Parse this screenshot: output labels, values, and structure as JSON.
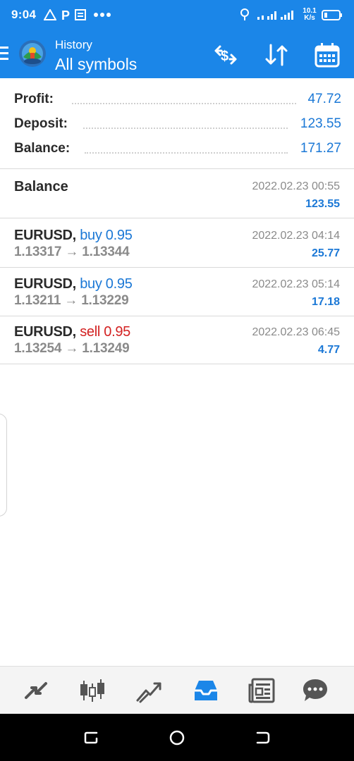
{
  "status_bar": {
    "time": "9:04",
    "speed_top": "10.1",
    "speed_bottom": "K/s"
  },
  "app_bar": {
    "title": "History",
    "subtitle": "All symbols"
  },
  "summary": [
    {
      "label": "Profit:",
      "value": "47.72"
    },
    {
      "label": "Deposit:",
      "value": "123.55"
    },
    {
      "label": "Balance:",
      "value": "171.27"
    }
  ],
  "balance_entry": {
    "title": "Balance",
    "date": "2022.02.23 00:55",
    "amount": "123.55"
  },
  "trades": [
    {
      "symbol": "EURUSD,",
      "side": "buy 0.95",
      "side_type": "buy",
      "prices": "1.13317 → 1.13344",
      "date": "2022.02.23 04:14",
      "amount": "25.77"
    },
    {
      "symbol": "EURUSD,",
      "side": "buy 0.95",
      "side_type": "buy",
      "prices": "1.13211 → 1.13229",
      "date": "2022.02.23 05:14",
      "amount": "17.18"
    },
    {
      "symbol": "EURUSD,",
      "side": "sell 0.95",
      "side_type": "sell",
      "prices": "1.13254 → 1.13249",
      "date": "2022.02.23 06:45",
      "amount": "4.77"
    }
  ],
  "bottom_nav": [
    {
      "icon": "quotes-icon"
    },
    {
      "icon": "chart-icon"
    },
    {
      "icon": "trade-icon"
    },
    {
      "icon": "history-icon",
      "active": true
    },
    {
      "icon": "news-icon"
    },
    {
      "icon": "chat-icon"
    }
  ],
  "colors": {
    "brand_blue": "#1b86e8",
    "value_blue": "#1b78d6",
    "sell_red": "#d32121",
    "gray_text": "#8a8a8a"
  }
}
